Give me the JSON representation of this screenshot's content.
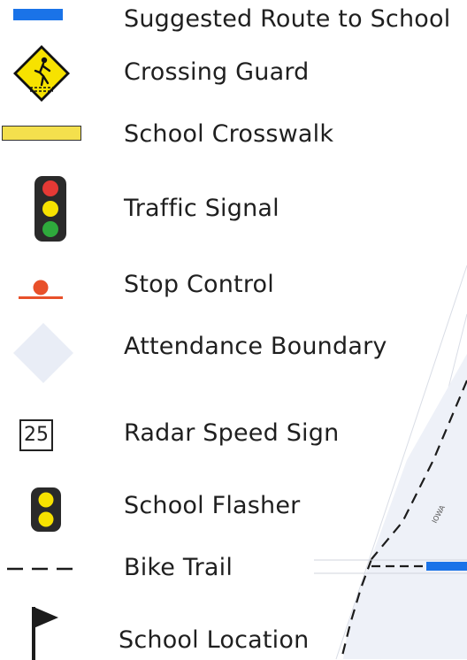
{
  "legend": {
    "items": [
      {
        "label": "Suggested Route to School",
        "symbol": "blue-route-bar"
      },
      {
        "label": "Crossing Guard",
        "symbol": "pedestrian-crossing-sign-icon"
      },
      {
        "label": "School Crosswalk",
        "symbol": "yellow-crosswalk-bar"
      },
      {
        "label": "Traffic Signal",
        "symbol": "traffic-light-icon"
      },
      {
        "label": "Stop Control",
        "symbol": "stop-control-icon"
      },
      {
        "label": "Attendance Boundary",
        "symbol": "boundary-diamond"
      },
      {
        "label": "Radar Speed Sign",
        "symbol": "speed-sign-icon",
        "speed_value": "25"
      },
      {
        "label": "School Flasher",
        "symbol": "school-flasher-icon"
      },
      {
        "label": "Bike Trail",
        "symbol": "dashed-line"
      },
      {
        "label": "School Location",
        "symbol": "flag-icon"
      }
    ]
  },
  "map": {
    "street_label": "IOWA"
  },
  "colors": {
    "route_blue": "#1a73e8",
    "crossing_yellow": "#f7e200",
    "crosswalk_yellow": "#f4e04d",
    "signal_red": "#e53935",
    "signal_yellow": "#f7e200",
    "signal_green": "#2eaa3c",
    "stop_orange": "#e8502a",
    "boundary_fill": "#e9edf6"
  }
}
